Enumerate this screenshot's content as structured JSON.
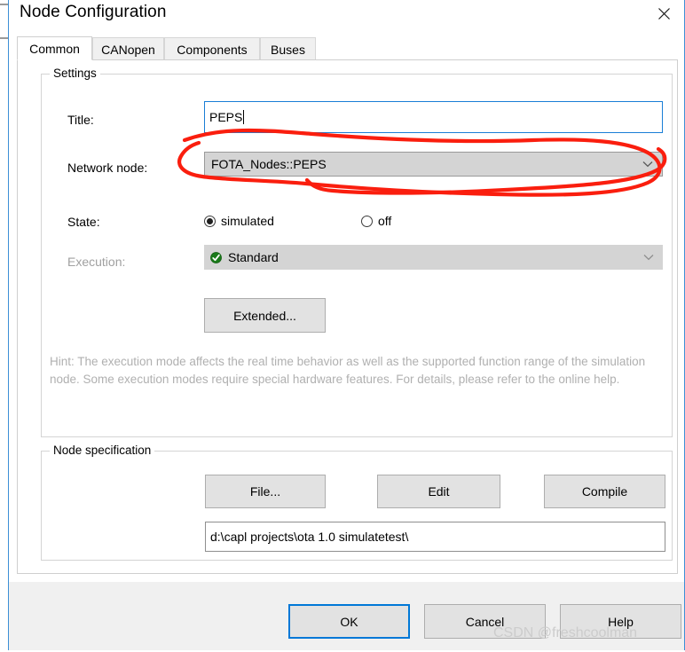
{
  "window": {
    "title": "Node Configuration",
    "close_icon": "close-icon"
  },
  "tabs": [
    {
      "label": "Common",
      "active": true
    },
    {
      "label": "CANopen",
      "active": false
    },
    {
      "label": "Components",
      "active": false
    },
    {
      "label": "Buses",
      "active": false
    }
  ],
  "settings": {
    "group_title": "Settings",
    "title_label": "Title:",
    "title_value": "PEPS",
    "title_placeholder": "",
    "network_node_label": "Network node:",
    "network_node_value": "FOTA_Nodes::PEPS",
    "state_label": "State:",
    "state_options": [
      {
        "label": "simulated",
        "checked": true
      },
      {
        "label": "off",
        "checked": false
      }
    ],
    "execution_label": "Execution:",
    "execution_value": "Standard",
    "execution_status_icon": "green-check-icon",
    "extended_button": "Extended...",
    "hint": "Hint: The execution mode affects the real time behavior as well as the supported function range of the simulation node. Some execution modes require special hardware features. For details, please refer to the online help."
  },
  "node_specification": {
    "group_title": "Node specification",
    "file_button": "File...",
    "edit_button": "Edit",
    "compile_button": "Compile",
    "path_value": "d:\\capl projects\\ota 1.0 simulatetest\\",
    "path_placeholder": ""
  },
  "footer": {
    "ok_button": "OK",
    "cancel_button": "Cancel",
    "help_button": "Help"
  },
  "annotation": {
    "type": "hand-drawn-red-ellipse",
    "color": "#fa1e0e",
    "target": "network-node-combo"
  },
  "watermark": {
    "text": "CSDN @freshcoolman",
    "color": "#cccccc"
  },
  "colors": {
    "accent_blue": "#0078d7",
    "window_border": "#3d8fd6",
    "panel_bg": "#ffffff",
    "footer_bg": "#f0f0f0",
    "combo_bg": "#d4d4d4",
    "button_bg": "#e2e2e2",
    "disabled_text": "#a0a0a0",
    "hint_text": "#b0b0b0"
  }
}
